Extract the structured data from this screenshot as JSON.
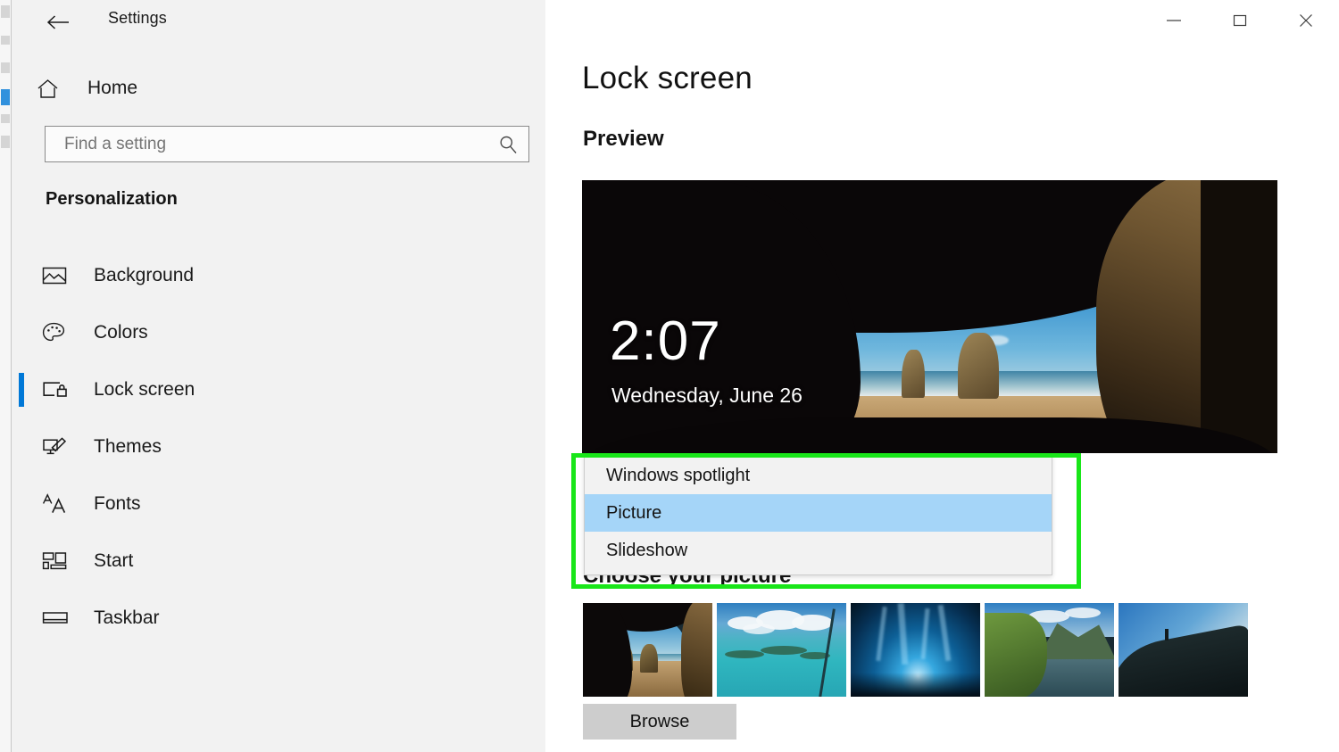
{
  "window": {
    "app_title": "Settings",
    "back_icon": "back-arrow-icon",
    "controls": {
      "minimize": "minimize-icon",
      "maximize": "maximize-icon",
      "close": "close-icon"
    }
  },
  "sidebar": {
    "home_label": "Home",
    "home_icon": "home-icon",
    "search": {
      "value": "",
      "placeholder": "Find a setting",
      "icon": "search-icon"
    },
    "section_header": "Personalization",
    "items": [
      {
        "label": "Background",
        "icon": "image-icon",
        "selected": false
      },
      {
        "label": "Colors",
        "icon": "palette-icon",
        "selected": false
      },
      {
        "label": "Lock screen",
        "icon": "lock-screen-icon",
        "selected": true
      },
      {
        "label": "Themes",
        "icon": "brush-icon",
        "selected": false
      },
      {
        "label": "Fonts",
        "icon": "fonts-icon",
        "selected": false
      },
      {
        "label": "Start",
        "icon": "start-tiles-icon",
        "selected": false
      },
      {
        "label": "Taskbar",
        "icon": "taskbar-icon",
        "selected": false
      }
    ]
  },
  "main": {
    "page_title": "Lock screen",
    "preview_label": "Preview",
    "lock_preview": {
      "time": "2:07",
      "date": "Wednesday, June 26"
    },
    "background_dropdown": {
      "selected": "Picture",
      "expanded": true,
      "options": [
        {
          "label": "Windows spotlight",
          "highlighted": false
        },
        {
          "label": "Picture",
          "highlighted": true
        },
        {
          "label": "Slideshow",
          "highlighted": false
        }
      ]
    },
    "choose_picture_label": "Choose your picture",
    "thumbnails": [
      {
        "name": "cave-beach-thumbnail",
        "selected": true
      },
      {
        "name": "tropical-lagoon-thumbnail",
        "selected": false
      },
      {
        "name": "ice-cave-thumbnail",
        "selected": false
      },
      {
        "name": "fjord-lake-thumbnail",
        "selected": false
      },
      {
        "name": "cliff-dusk-thumbnail",
        "selected": false
      }
    ],
    "browse_label": "Browse"
  },
  "annotation": {
    "type": "highlight-rectangle",
    "color": "#19e619",
    "target": "background-dropdown-list"
  },
  "colors": {
    "accent": "#0078d7",
    "sidebar_bg": "#f2f2f2",
    "content_bg": "#ffffff",
    "dropdown_bg": "#f2f2f2",
    "dropdown_highlight": "#a5d5f8",
    "button_bg": "#cdcdcd",
    "annotation_green": "#19e619"
  }
}
